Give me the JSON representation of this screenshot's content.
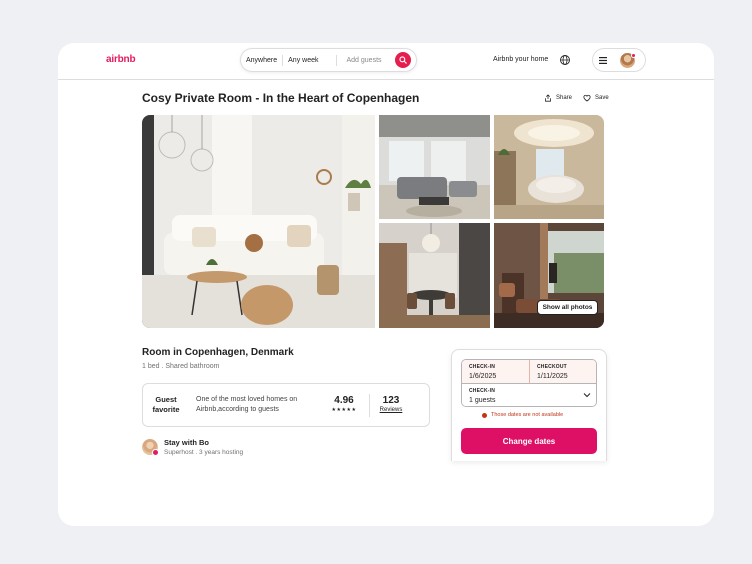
{
  "header": {
    "logo": "airbnb",
    "search": {
      "where": "Anywhere",
      "when": "Any week",
      "guests_placeholder": "Add guests"
    },
    "host_link": "Airbnb your home",
    "icons": {
      "search": "search-icon",
      "globe": "globe-icon",
      "menu": "hamburger-icon"
    }
  },
  "listing": {
    "title": "Cosy Private Room - In the Heart of Copenhagen",
    "share_label": "Share",
    "save_label": "Save",
    "show_all_photos": "Show all photos",
    "room_type": "Room in Copenhagen, Denmark",
    "room_details": "1 bed . Shared bathroom"
  },
  "guest_favorite": {
    "badge": "Guest favorite",
    "description": "One of the most loved homes on Airbnb,according to guests",
    "rating": "4.96",
    "stars": "★★★★★",
    "reviews_count": "123",
    "reviews_label": "Reviews"
  },
  "host": {
    "name": "Stay with Bo",
    "subtitle": "Superhost . 3 years hosting"
  },
  "booking": {
    "checkin_label": "CHECK-IN",
    "checkin_value": "1/6/2025",
    "checkout_label": "CHECKOUT",
    "checkout_value": "1/11/2025",
    "guests_label": "CHECK-IN",
    "guests_value": "1 guests",
    "error": "Those dates are not available",
    "cta": "Change dates"
  },
  "colors": {
    "brand": "#e31c5f",
    "cta": "#dd1066",
    "error": "#c13515"
  }
}
